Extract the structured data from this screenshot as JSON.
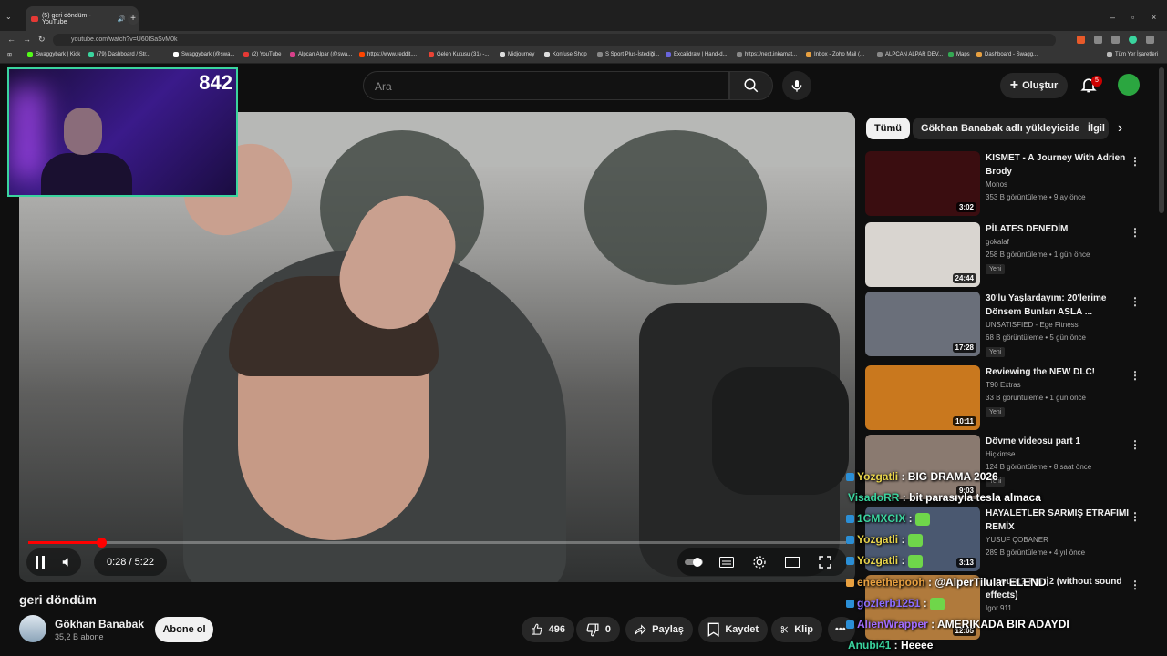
{
  "browser": {
    "tab_title": "(5) geri döndüm - YouTube",
    "url": "youtube.com/watch?v=U60ISaSvM0k",
    "bookmarks": [
      "Swaggybark | Kick",
      "(79) Dashboard / Str...",
      "Swaggybark (@swa...",
      "(2) YouTube",
      "Alpcan Alpar (@swa...",
      "https://www.reddit....",
      "Gelen Kutusu (31) -...",
      "Midjourney",
      "Konfuse Shop",
      "S Sport Plus-İstediği...",
      "Excalidraw | Hand-d...",
      "https://next.inkamat...",
      "Inbox - Zoho Mail (...",
      "ALPCAN ALPAR DEV...",
      "Maps",
      "Dashboard - Swagg...",
      "Tüm Yer İşaretleri"
    ]
  },
  "header": {
    "search_placeholder": "Ara",
    "create_label": "Oluştur",
    "notification_count": "5"
  },
  "webcam": {
    "counter": "842"
  },
  "player": {
    "time": "0:28 / 5:22",
    "progress": 0.0895
  },
  "video": {
    "title": "geri döndüm",
    "channel": "Gökhan Banabak",
    "subscribers": "35,2 B abone",
    "subscribe_label": "Abone ol",
    "likes": "496",
    "dislikes": "0",
    "share_label": "Paylaş",
    "save_label": "Kaydet",
    "clip_label": "Klip"
  },
  "chips": [
    "Tümü",
    "Gökhan Banabak adlı yükleyiciden",
    "İlgil"
  ],
  "recommendations": [
    {
      "title": "KISMET - A Journey With Adrien Brody",
      "channel": "Monos",
      "meta": "353 B görüntüleme • 9 ay önce",
      "duration": "3:02",
      "new": "",
      "thumb_color": "#3a0d10"
    },
    {
      "title": "PİLATES DENEDİM",
      "channel": "gokalaf",
      "meta": "258 B görüntüleme • 1 gün önce",
      "duration": "24:44",
      "new": "Yeni",
      "thumb_color": "#d9d5d0"
    },
    {
      "title": "30'lu Yaşlardayım: 20'lerime Dönsem Bunları ASLA ...",
      "channel": "UNSATISFIED - Ege Fitness",
      "meta": "68 B görüntüleme • 5 gün önce",
      "duration": "17:28",
      "new": "Yeni",
      "thumb_color": "#6a6f7a"
    },
    {
      "title": "Reviewing the NEW DLC!",
      "channel": "T90 Extras",
      "meta": "33 B görüntüleme • 1 gün önce",
      "duration": "10:11",
      "new": "Yeni",
      "thumb_color": "#c9781e"
    },
    {
      "title": "Dövme videosu part 1",
      "channel": "Hiçkimse",
      "meta": "124 B görüntüleme • 8 saat önce",
      "duration": "9:03",
      "new": "Yeni",
      "thumb_color": "#8a7a70"
    },
    {
      "title": "HAYALETLER SARMIŞ ETRAFIMI REMİX",
      "channel": "YUSUF ÇOBANER",
      "meta": "289 B görüntüleme • 4 yıl önce",
      "duration": "3:13",
      "new": "",
      "thumb_color": "#4a5870"
    },
    {
      "title": "... count? Part 2 (without sound effects)",
      "channel": "Igor 911",
      "meta": "",
      "duration": "12:05",
      "new": "",
      "thumb_color": "#b07a3c"
    }
  ],
  "chat": [
    {
      "user": "Yozgatli",
      "message": "BIG DRAMA 2026",
      "user_color": "#e8d44a"
    },
    {
      "user": "VisadoRR",
      "message": "bit parasıyla tesla almaca",
      "user_color": "#3ad49e"
    },
    {
      "user": "1CMXCIX",
      "message": "",
      "user_color": "#3ad49e"
    },
    {
      "user": "Yozgatli",
      "message": "",
      "user_color": "#e8d44a"
    },
    {
      "user": "Yozgatli",
      "message": "",
      "user_color": "#e8d44a"
    },
    {
      "user": "eneethepooh",
      "message": "@AlperTilular ELENDİ",
      "user_color": "#e8a040"
    },
    {
      "user": "gozlerb1251",
      "message": "",
      "user_color": "#8a6cff"
    },
    {
      "user": "AlienWrapper",
      "message": "AMERIKADA BIR ADAYDI",
      "user_color": "#a06cff"
    },
    {
      "user": "Anubi41",
      "message": "Heeee",
      "user_color": "#3ad49e"
    }
  ]
}
